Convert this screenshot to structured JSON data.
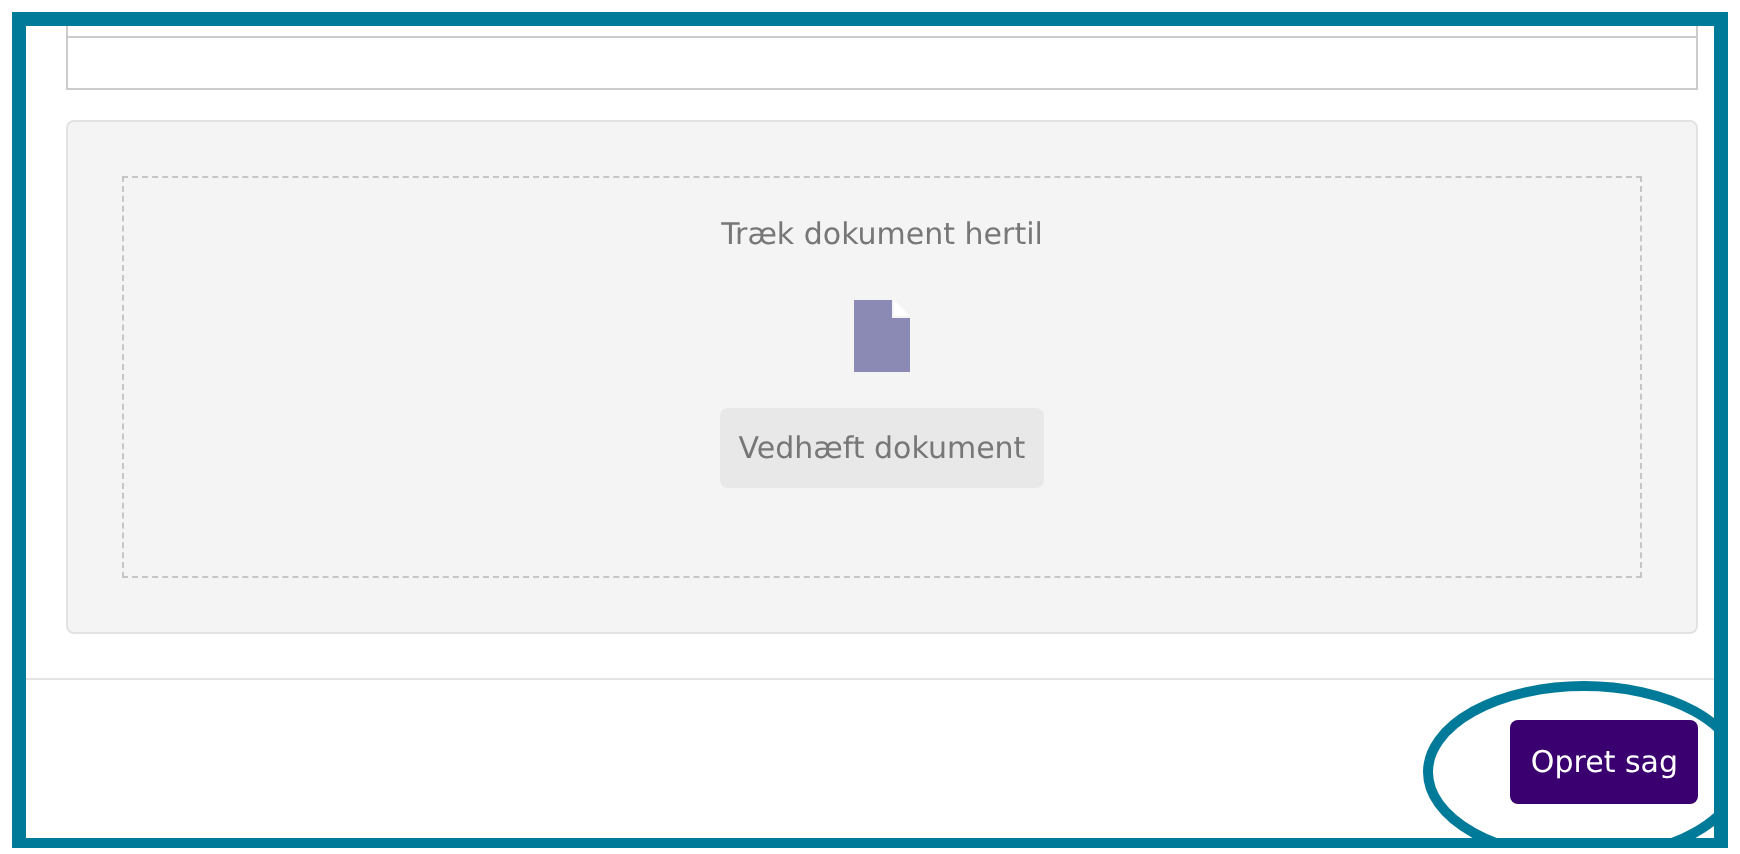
{
  "drop_zone": {
    "hint": "Træk dokument hertil",
    "button": "Vedhæft dokument"
  },
  "submit_button": "Opret sag"
}
